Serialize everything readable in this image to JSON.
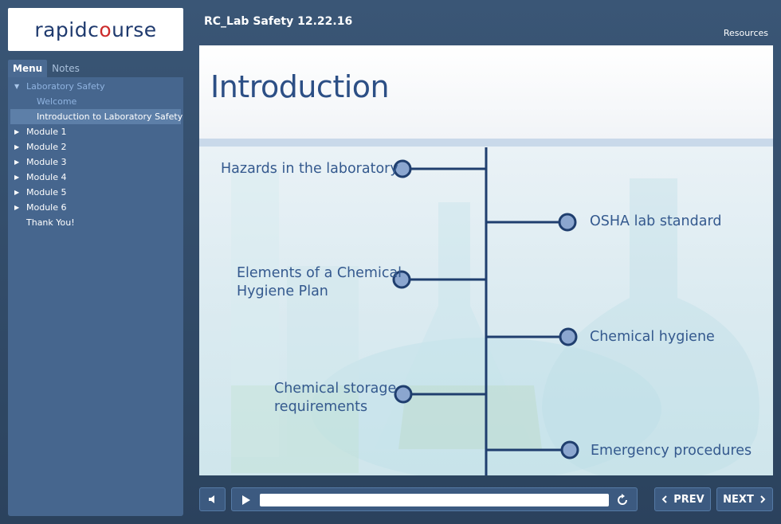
{
  "app": {
    "logo_part1": "rapidc",
    "logo_part2": "o",
    "logo_part3": "urse",
    "course_title": "RC_Lab Safety 12.22.16",
    "resources_label": "Resources"
  },
  "sidebar": {
    "tabs": [
      {
        "label": "Menu",
        "active": true
      },
      {
        "label": "Notes",
        "active": false
      }
    ],
    "items": [
      {
        "label": "Laboratory Safety",
        "arrow": "▼",
        "dim": true
      },
      {
        "label": "Welcome",
        "sub": true,
        "dim": true
      },
      {
        "label": "Introduction to Laboratory Safety",
        "sub": true,
        "selected": true
      },
      {
        "label": "Module 1",
        "arrow": "▶"
      },
      {
        "label": "Module 2",
        "arrow": "▶"
      },
      {
        "label": "Module 3",
        "arrow": "▶"
      },
      {
        "label": "Module 4",
        "arrow": "▶"
      },
      {
        "label": "Module 5",
        "arrow": "▶"
      },
      {
        "label": "Module 6",
        "arrow": "▶"
      },
      {
        "label": "Thank You!"
      }
    ]
  },
  "slide": {
    "title": "Introduction",
    "topics_left": [
      {
        "line1": "Hazards in the laboratory",
        "line2": ""
      },
      {
        "line1": "Elements of a Chemical",
        "line2": "Hygiene Plan"
      },
      {
        "line1": "Chemical storage",
        "line2": "requirements"
      }
    ],
    "topics_right": [
      {
        "line1": "OSHA lab standard"
      },
      {
        "line1": "Chemical hygiene"
      },
      {
        "line1": "Emergency procedures"
      }
    ],
    "colors": {
      "accent": "#2c4f85",
      "node_fill": "#8ba6cf",
      "line": "#1f3e6e"
    }
  },
  "controls": {
    "prev_label": "PREV",
    "next_label": "NEXT",
    "prev_icon": "chevron-left-icon",
    "next_icon": "chevron-right-icon",
    "volume_icon": "speaker-icon",
    "play_icon": "play-icon",
    "replay_icon": "replay-icon",
    "progress": 0.0
  }
}
